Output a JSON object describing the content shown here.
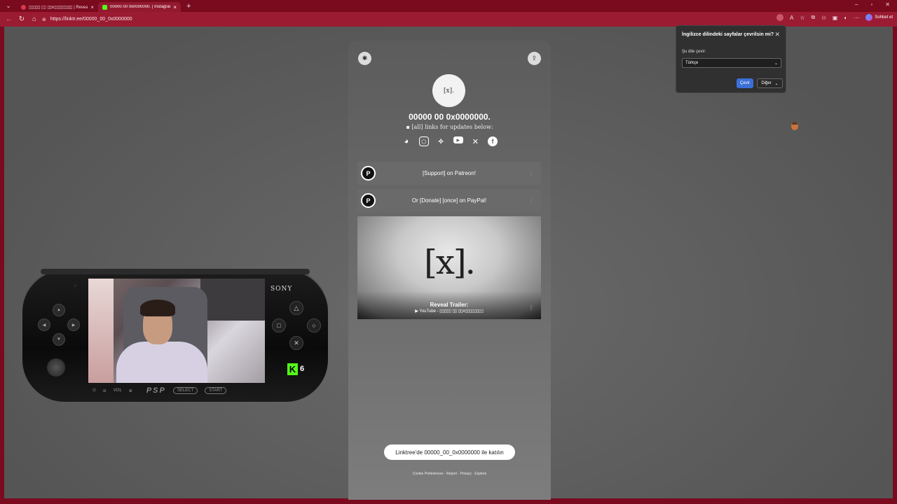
{
  "browser": {
    "tabs": [
      {
        "title": "▯▯▯▯▯ ▯▯ ▯▯x▯▯▯▯▯▯▯▯ | Reveal",
        "color": "#d63a4f"
      },
      {
        "title": "00000 00 0x0000000. | Instagram,",
        "color": "#53fc18"
      }
    ],
    "url": "https://linktr.ee/00000_00_0x0000000",
    "chat_label": "Sohbet et"
  },
  "linktree": {
    "avatar_text": "[x].",
    "name": "00000 00 0x0000000.",
    "bio": "[all] links for updates below:",
    "social_icons": [
      "discord-icon",
      "instagram-icon",
      "bluesky-icon",
      "youtube-icon",
      "x-icon",
      "facebook-icon"
    ],
    "links": [
      {
        "label": "[Support] on Patreon!",
        "icon": "patreon-icon"
      },
      {
        "label": "Or [Donate] [once] on PayPal!",
        "icon": "paypal-icon"
      }
    ],
    "trailer": {
      "logo": "[x].",
      "title": "Reveal Trailer:",
      "subtitle": "▶ YouTube - ▯▯▯▯▯ ▯▯ ▯▯x▯▯▯▯▯▯▯▯"
    },
    "join_label": "Linktree'de 00000_00_0x0000000 ile katılın",
    "footer": "Cookie Preferences · Report · Privacy · Explore"
  },
  "translate_popup": {
    "question": "İngilizce dilindeki sayfalar çevrilsin mi?",
    "label": "Şu dile çevir:",
    "selected_language": "Türkçe",
    "translate_button": "Çevir",
    "other_button": "Diğer"
  },
  "psp_overlay": {
    "brand": "SONY",
    "kick_count": "6",
    "vol_label": "VOL",
    "logo": "PSP",
    "select_label": "SELECT",
    "start_label": "START"
  }
}
